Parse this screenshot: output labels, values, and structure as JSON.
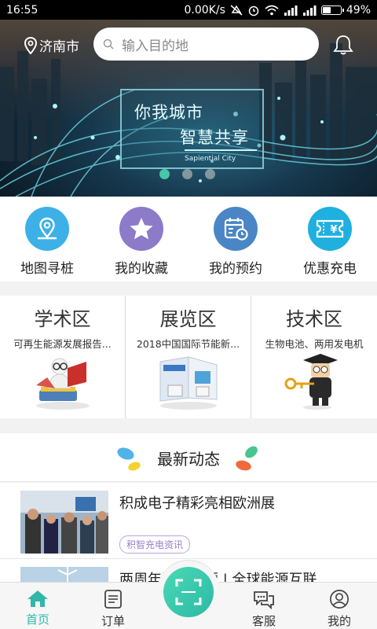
{
  "status_bar": {
    "time": "16:55",
    "network_speed": "0.00K/s",
    "battery": "49%",
    "battery_level": 0.49
  },
  "banner": {
    "city": "济南市",
    "search_placeholder": "输入目的地",
    "slogan_line1": "你我城市",
    "slogan_line2": "智慧共享",
    "slogan_en": "Sapiential City",
    "slide_count": 3,
    "active_slide": 0
  },
  "quick_actions": [
    {
      "label": "地图寻桩",
      "icon": "map-pin-icon",
      "color": "#3db0e8"
    },
    {
      "label": "我的收藏",
      "icon": "star-icon",
      "color": "#8d7ac9"
    },
    {
      "label": "我的预约",
      "icon": "calendar-clock-icon",
      "color": "#4a86c5"
    },
    {
      "label": "优惠充电",
      "icon": "coupon-icon",
      "color": "#1fb0e0"
    }
  ],
  "zones": [
    {
      "title": "学术区",
      "subtitle": "可再生能源发展报告..."
    },
    {
      "title": "展览区",
      "subtitle": "2018中国国际节能新..."
    },
    {
      "title": "技术区",
      "subtitle": "生物电池、两用发电机"
    }
  ],
  "news": {
    "header": "最新动态",
    "items": [
      {
        "title": "积成电子精彩亮相欧洲展",
        "tag": "积智充电资讯"
      },
      {
        "title": "两周年回顾回顾 | 全球能源互联",
        "tag": ""
      }
    ]
  },
  "bottom_nav": [
    {
      "label": "首页",
      "icon": "home-icon",
      "active": true
    },
    {
      "label": "订单",
      "icon": "order-icon",
      "active": false
    },
    {
      "label": "客服",
      "icon": "chat-icon",
      "active": false
    },
    {
      "label": "我的",
      "icon": "user-icon",
      "active": false
    }
  ],
  "colors": {
    "accent": "#2fb8a8",
    "tag": "#9b7fc9"
  }
}
